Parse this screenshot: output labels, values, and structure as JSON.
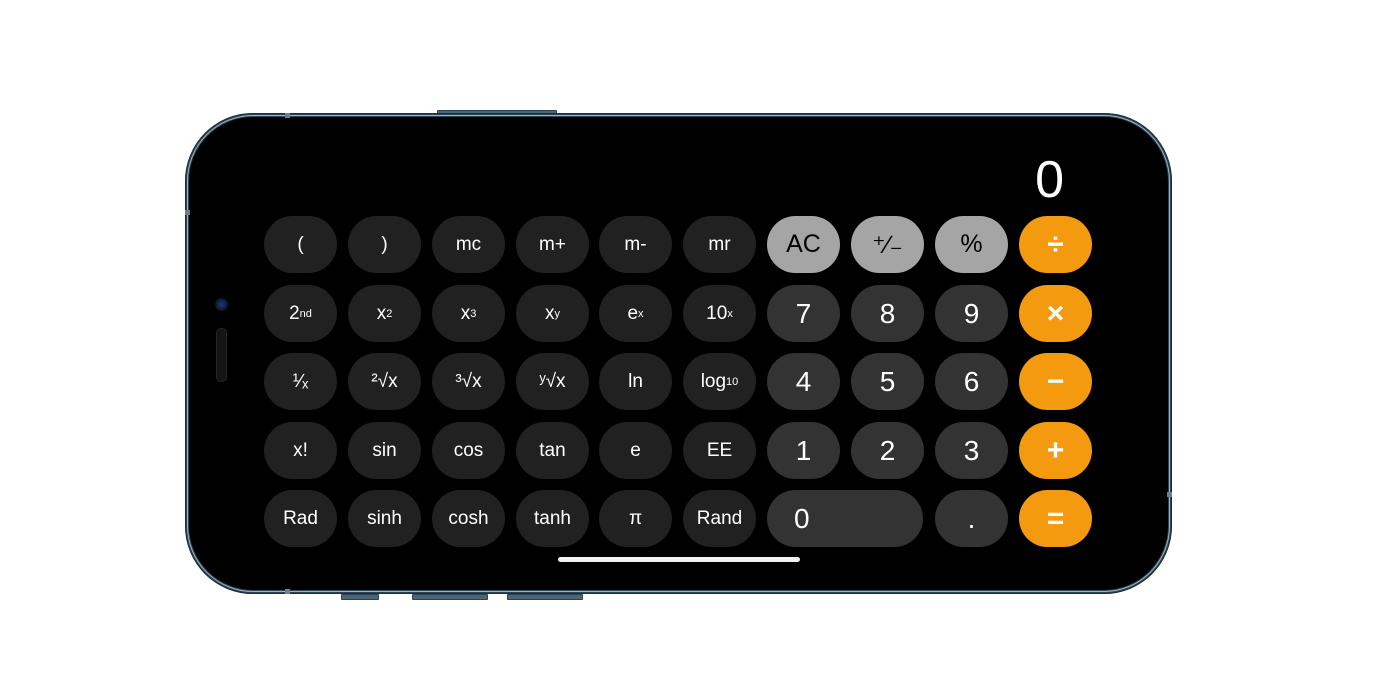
{
  "device": {
    "type": "iPhone (landscape)",
    "frame_color": "#2c4556"
  },
  "calculator": {
    "display_value": "0",
    "colors": {
      "scientific_key": "#212121",
      "number_key": "#333333",
      "utility_key": "#a5a5a5",
      "operator_key": "#f49a0f",
      "background": "#000000"
    },
    "rows": [
      [
        {
          "id": "open-paren",
          "label": "(",
          "kind": "sci"
        },
        {
          "id": "close-paren",
          "label": ")",
          "kind": "sci"
        },
        {
          "id": "memory-clear",
          "label": "mc",
          "kind": "sci"
        },
        {
          "id": "memory-add",
          "label": "m+",
          "kind": "sci"
        },
        {
          "id": "memory-subtract",
          "label": "m-",
          "kind": "sci"
        },
        {
          "id": "memory-recall",
          "label": "mr",
          "kind": "sci"
        },
        {
          "id": "all-clear",
          "label": "AC",
          "kind": "util"
        },
        {
          "id": "plus-minus",
          "label": "⁺∕₋",
          "kind": "util"
        },
        {
          "id": "percent",
          "label": "%",
          "kind": "util"
        },
        {
          "id": "divide",
          "label": "÷",
          "kind": "op"
        }
      ],
      [
        {
          "id": "second",
          "label": "2",
          "sup": "nd",
          "kind": "sci"
        },
        {
          "id": "square",
          "label": "x",
          "sup": "2",
          "kind": "sci"
        },
        {
          "id": "cube",
          "label": "x",
          "sup": "3",
          "kind": "sci"
        },
        {
          "id": "power",
          "label": "x",
          "sup": "y",
          "kind": "sci"
        },
        {
          "id": "exp",
          "label": "e",
          "sup": "x",
          "kind": "sci"
        },
        {
          "id": "ten-power",
          "label": "10",
          "sup": "x",
          "kind": "sci"
        },
        {
          "id": "seven",
          "label": "7",
          "kind": "num"
        },
        {
          "id": "eight",
          "label": "8",
          "kind": "num"
        },
        {
          "id": "nine",
          "label": "9",
          "kind": "num"
        },
        {
          "id": "multiply",
          "label": "×",
          "kind": "op"
        }
      ],
      [
        {
          "id": "reciprocal",
          "label": "¹∕ₓ",
          "kind": "sci"
        },
        {
          "id": "square-root",
          "label": "²√x",
          "kind": "sci"
        },
        {
          "id": "cube-root",
          "label": "³√x",
          "kind": "sci"
        },
        {
          "id": "y-root",
          "label": "ʸ√x",
          "kind": "sci"
        },
        {
          "id": "ln",
          "label": "ln",
          "kind": "sci"
        },
        {
          "id": "log10",
          "label": "log",
          "sub": "10",
          "kind": "sci"
        },
        {
          "id": "four",
          "label": "4",
          "kind": "num"
        },
        {
          "id": "five",
          "label": "5",
          "kind": "num"
        },
        {
          "id": "six",
          "label": "6",
          "kind": "num"
        },
        {
          "id": "subtract",
          "label": "−",
          "kind": "op"
        }
      ],
      [
        {
          "id": "factorial",
          "label": "x!",
          "kind": "sci"
        },
        {
          "id": "sin",
          "label": "sin",
          "kind": "sci"
        },
        {
          "id": "cos",
          "label": "cos",
          "kind": "sci"
        },
        {
          "id": "tan",
          "label": "tan",
          "kind": "sci"
        },
        {
          "id": "euler",
          "label": "e",
          "kind": "sci"
        },
        {
          "id": "ee",
          "label": "EE",
          "kind": "sci"
        },
        {
          "id": "one",
          "label": "1",
          "kind": "num"
        },
        {
          "id": "two",
          "label": "2",
          "kind": "num"
        },
        {
          "id": "three",
          "label": "3",
          "kind": "num"
        },
        {
          "id": "add",
          "label": "+",
          "kind": "op"
        }
      ],
      [
        {
          "id": "rad",
          "label": "Rad",
          "kind": "sci"
        },
        {
          "id": "sinh",
          "label": "sinh",
          "kind": "sci"
        },
        {
          "id": "cosh",
          "label": "cosh",
          "kind": "sci"
        },
        {
          "id": "tanh",
          "label": "tanh",
          "kind": "sci"
        },
        {
          "id": "pi",
          "label": "π",
          "kind": "sci"
        },
        {
          "id": "rand",
          "label": "Rand",
          "kind": "sci"
        },
        {
          "id": "zero",
          "label": "0",
          "kind": "num",
          "wide": true
        },
        {
          "id": "decimal",
          "label": ".",
          "kind": "num"
        },
        {
          "id": "equals",
          "label": "=",
          "kind": "op"
        }
      ]
    ]
  }
}
